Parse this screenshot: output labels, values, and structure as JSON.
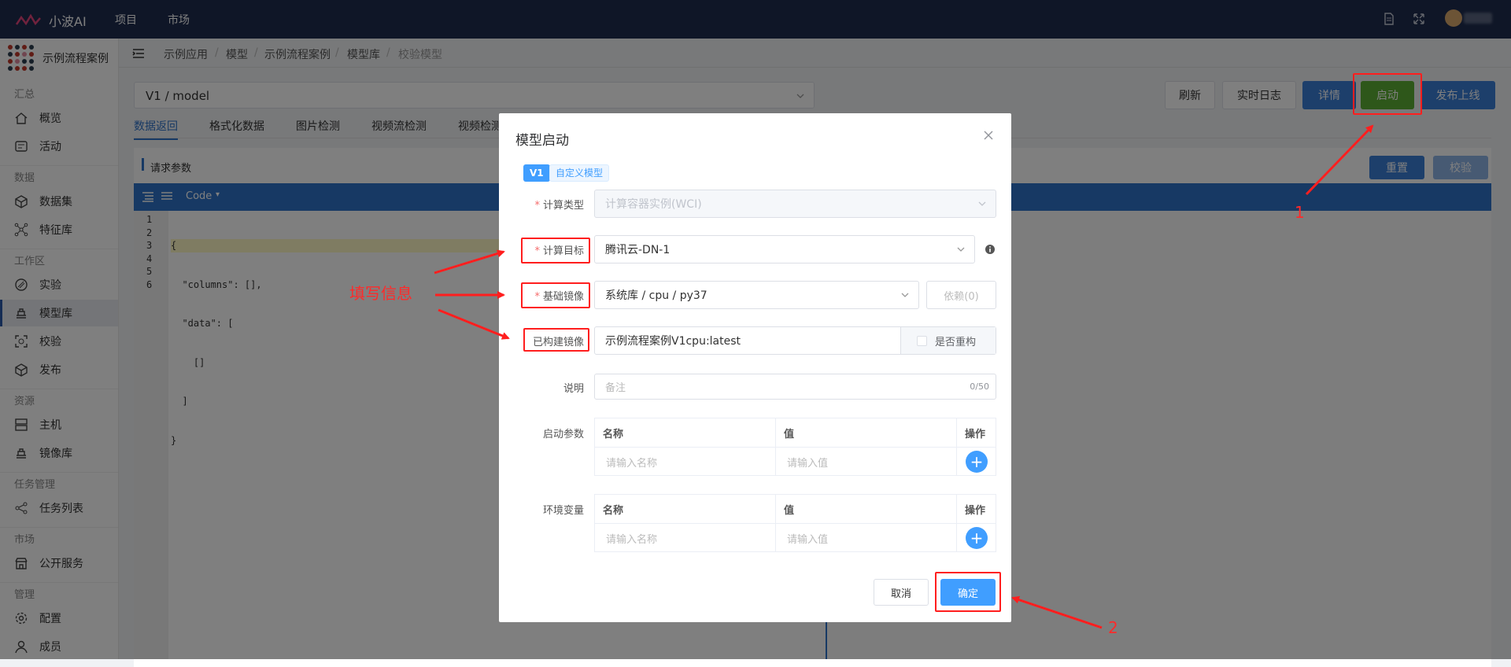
{
  "topbar": {
    "brand": "小波AI",
    "nav": [
      "项目",
      "市场"
    ]
  },
  "sidebar": {
    "app_name": "示例流程案例",
    "groups": {
      "summary": "汇总",
      "data": "数据",
      "workspace": "工作区",
      "resource": "资源",
      "task": "任务管理",
      "market": "市场",
      "manage": "管理"
    },
    "items": {
      "overview": "概览",
      "activity": "活动",
      "dataset": "数据集",
      "feature": "特征库",
      "experiment": "实验",
      "model": "模型库",
      "verify": "校验",
      "publish": "发布",
      "host": "主机",
      "image": "镜像库",
      "tasklist": "任务列表",
      "public": "公开服务",
      "config": "配置",
      "member": "成员"
    }
  },
  "breadcrumb": [
    "示例应用",
    "模型",
    "示例流程案例",
    "模型库",
    "校验模型"
  ],
  "model_select": "V1 / model",
  "toolbar": {
    "refresh": "刷新",
    "log": "实时日志",
    "detail": "详情",
    "start": "启动",
    "online": "发布上线"
  },
  "tabs": [
    "数据返回",
    "格式化数据",
    "图片检测",
    "视频流检测",
    "视频检测"
  ],
  "request": {
    "title": "请求参数",
    "reset": "重置",
    "verify": "校验",
    "mode": "Code"
  },
  "code_lines": [
    "{",
    "  \"columns\": [],",
    "  \"data\": [",
    "    []",
    "  ]",
    "}"
  ],
  "line_numbers": [
    "1",
    "2",
    "3",
    "4",
    "5",
    "6"
  ],
  "modal": {
    "title": "模型启动",
    "version_tag": "V1",
    "model_tag": "自定义模型",
    "compute_type_label": "计算类型",
    "compute_type_value": "计算容器实例(WCI)",
    "target_label": "计算目标",
    "target_value": "腾讯云-DN-1",
    "base_image_label": "基础镜像",
    "base_image_value": "系统库 / cpu / py37",
    "deps_button": "依赖(0)",
    "built_image_label": "已构建镜像",
    "built_image_value": "示例流程案例V1cpu:latest",
    "rebuild_label": "是否重构",
    "desc_label": "说明",
    "desc_placeholder": "备注",
    "desc_count": "0/50",
    "start_params_label": "启动参数",
    "env_label": "环境变量",
    "col_name": "名称",
    "col_value": "值",
    "col_action": "操作",
    "name_placeholder": "请输入名称",
    "value_placeholder": "请输入值",
    "cancel": "取消",
    "confirm": "确定"
  },
  "annotations": {
    "fill_info": "填写信息",
    "step1": "1",
    "step2": "2"
  },
  "colors": {
    "topbar": "#1f2d4f",
    "primary": "#409eff",
    "annotation": "#ff1e1e",
    "start_button": "#5daf34"
  }
}
